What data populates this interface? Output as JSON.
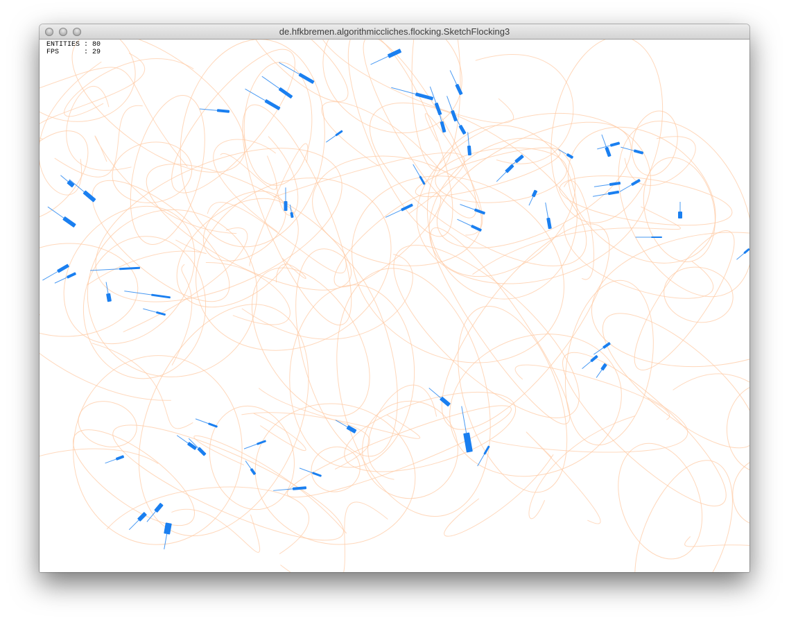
{
  "window": {
    "title": "de.hfkbremen.algorithmiccliches.flocking.SketchFlocking3"
  },
  "hud": {
    "entities_label": "ENTITIES",
    "entities_value": "80",
    "fps_label": "FPS",
    "fps_value": "29"
  },
  "colors": {
    "boid": "#1a7ff0",
    "trail": "#ffc9a3",
    "background": "#ffffff"
  }
}
